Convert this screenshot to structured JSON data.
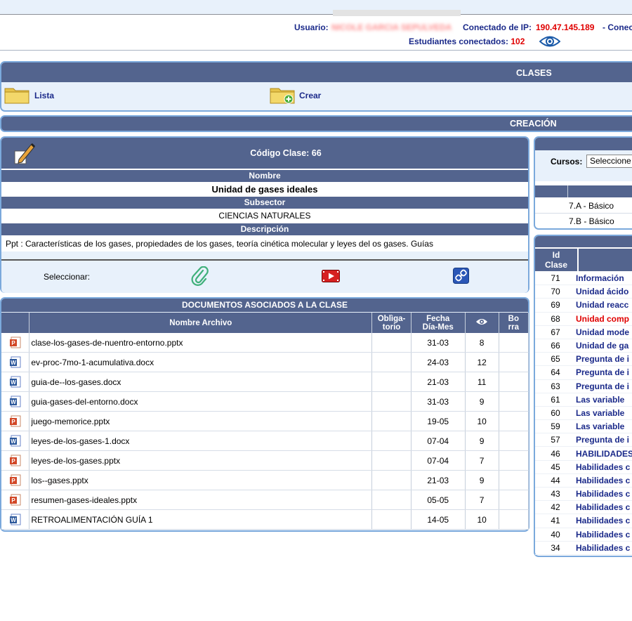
{
  "header": {
    "usuario_label": "Usuario:",
    "usuario_name": "NICOLE GARCIA SEPULVEDA",
    "ip_label": "Conectado de IP:",
    "ip_value": "190.47.145.189",
    "ip_suffix": "- Conec",
    "students_label": "Estudiantes conectados:",
    "students_value": "102"
  },
  "clases_panel": {
    "title": "CLASES",
    "lista_label": "Lista",
    "crear_label": "Crear"
  },
  "creacion": {
    "title": "CREACIÓN",
    "codigo": "Código Clase: 66",
    "nombre_label": "Nombre",
    "nombre_value": "Unidad de gases ideales",
    "subsector_label": "Subsector",
    "subsector_value": "CIENCIAS NATURALES",
    "descripcion_label": "Descripción",
    "descripcion_value": "Ppt : Características de los gases, propiedades de los gases, teoría cinética molecular y leyes del os gases. Guías",
    "seleccionar_label": "Seleccionar:"
  },
  "documents": {
    "title": "DOCUMENTOS ASOCIADOS A LA CLASE",
    "col_nombre": "Nombre Archivo",
    "col_oblig_1": "Oblìga-",
    "col_oblig_2": "torio",
    "col_fecha_1": "Fecha",
    "col_fecha_2": "Día-Mes",
    "col_borra_1": "Bo",
    "col_borra_2": "rra",
    "rows": [
      {
        "type": "ppt",
        "name": "clase-los-gases-de-nuentro-entorno.pptx",
        "date": "31-03",
        "views": "8"
      },
      {
        "type": "doc",
        "name": "ev-proc-7mo-1-acumulativa.docx",
        "date": "24-03",
        "views": "12"
      },
      {
        "type": "doc",
        "name": "guia-de--los-gases.docx",
        "date": "21-03",
        "views": "11"
      },
      {
        "type": "doc",
        "name": "guia-gases-del-entorno.docx",
        "date": "31-03",
        "views": "9"
      },
      {
        "type": "ppt",
        "name": "juego-memorice.pptx",
        "date": "19-05",
        "views": "10"
      },
      {
        "type": "doc",
        "name": "leyes-de-los-gases-1.docx",
        "date": "07-04",
        "views": "9"
      },
      {
        "type": "ppt",
        "name": "leyes-de-los-gases.pptx",
        "date": "07-04",
        "views": "7"
      },
      {
        "type": "ppt",
        "name": "los--gases.pptx",
        "date": "21-03",
        "views": "9"
      },
      {
        "type": "ppt",
        "name": "resumen-gases-ideales.pptx",
        "date": "05-05",
        "views": "7"
      },
      {
        "type": "doc",
        "name": "RETROALIMENTACIÓN GUÍA 1",
        "date": "14-05",
        "views": "10"
      }
    ]
  },
  "cursos": {
    "label": "Cursos:",
    "select_value": "Seleccione",
    "items": [
      "7.A - Básico",
      "7.B - Básico"
    ]
  },
  "class_list": {
    "col_id_1": "Id",
    "col_id_2": "Clase",
    "rows": [
      {
        "id": "71",
        "title": "Información",
        "color": "#1b2a8a"
      },
      {
        "id": "70",
        "title": "Unidad ácido",
        "color": "#1b2a8a"
      },
      {
        "id": "69",
        "title": "Unidad reacc",
        "color": "#1b2a8a"
      },
      {
        "id": "68",
        "title": "Unidad comp",
        "color": "#e00000"
      },
      {
        "id": "67",
        "title": "Unidad mode",
        "color": "#1b2a8a"
      },
      {
        "id": "66",
        "title": "Unidad de ga",
        "color": "#1b2a8a"
      },
      {
        "id": "65",
        "title": "Pregunta de i",
        "color": "#1b2a8a"
      },
      {
        "id": "64",
        "title": "Pregunta de i",
        "color": "#1b2a8a"
      },
      {
        "id": "63",
        "title": "Pregunta de i",
        "color": "#1b2a8a"
      },
      {
        "id": "61",
        "title": "Las variable",
        "color": "#1b2a8a"
      },
      {
        "id": "60",
        "title": "Las variable",
        "color": "#1b2a8a"
      },
      {
        "id": "59",
        "title": "Las variable",
        "color": "#1b2a8a"
      },
      {
        "id": "57",
        "title": "Pregunta de i",
        "color": "#1b2a8a"
      },
      {
        "id": "46",
        "title": "HABILIDADES",
        "color": "#1b2a8a"
      },
      {
        "id": "45",
        "title": "Habilidades c",
        "color": "#1b2a8a"
      },
      {
        "id": "44",
        "title": "Habilidades c",
        "color": "#1b2a8a"
      },
      {
        "id": "43",
        "title": "Habilidades c",
        "color": "#1b2a8a"
      },
      {
        "id": "42",
        "title": "Habilidades c",
        "color": "#1b2a8a"
      },
      {
        "id": "41",
        "title": "Habilidades c",
        "color": "#1b2a8a"
      },
      {
        "id": "40",
        "title": "Habilidades c",
        "color": "#1b2a8a"
      },
      {
        "id": "34",
        "title": "Habilidades c",
        "color": "#1b2a8a"
      }
    ]
  }
}
